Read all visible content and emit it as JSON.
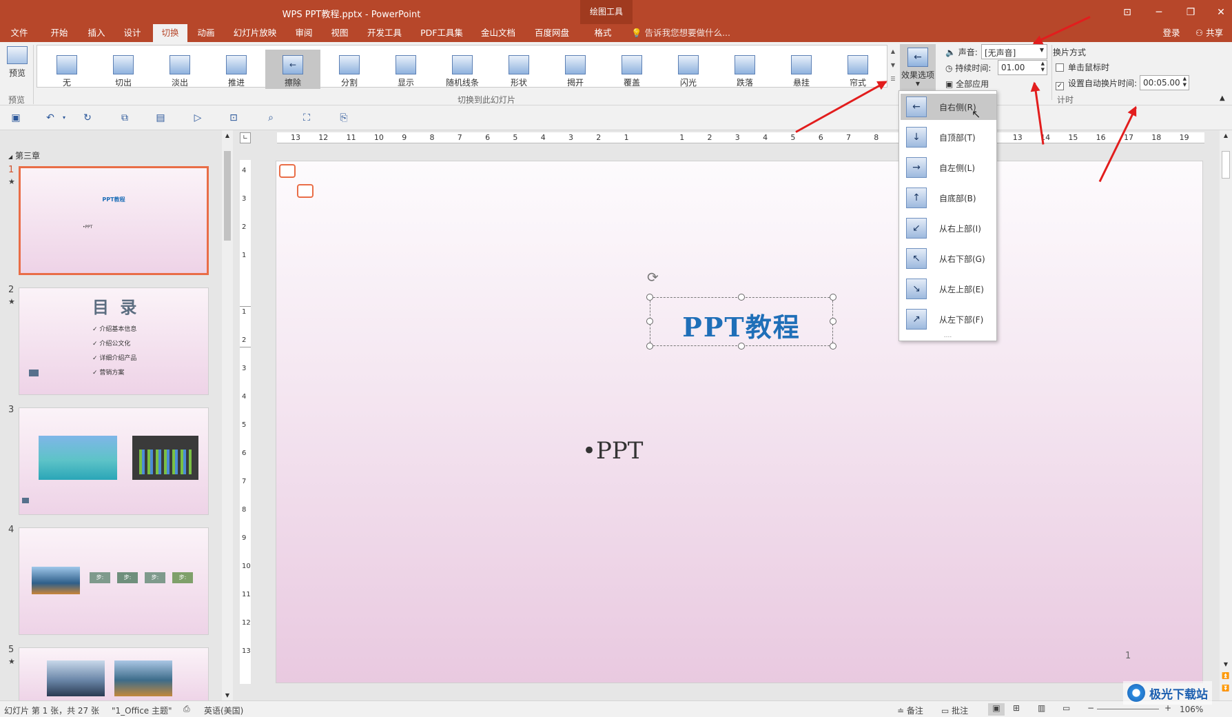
{
  "window": {
    "title": "WPS PPT教程.pptx - PowerPoint",
    "context_tab_group": "绘图工具",
    "minimize": "─",
    "restore": "❐",
    "close": "✕",
    "ribbon_display": "⊡"
  },
  "tabs": [
    {
      "label": "文件"
    },
    {
      "label": "开始"
    },
    {
      "label": "插入"
    },
    {
      "label": "设计"
    },
    {
      "label": "切换"
    },
    {
      "label": "动画"
    },
    {
      "label": "幻灯片放映"
    },
    {
      "label": "审阅"
    },
    {
      "label": "视图"
    },
    {
      "label": "开发工具"
    },
    {
      "label": "PDF工具集"
    },
    {
      "label": "金山文档"
    },
    {
      "label": "百度网盘"
    },
    {
      "label": "格式"
    }
  ],
  "tell_me": "告诉我您想要做什么...",
  "login": "登录",
  "share": "共享",
  "ribbon": {
    "preview_label": "预览",
    "preview_group": "预览",
    "transitions": [
      "无",
      "切出",
      "淡出",
      "推进",
      "擦除",
      "分割",
      "显示",
      "随机线条",
      "形状",
      "揭开",
      "覆盖",
      "闪光",
      "跌落",
      "悬挂",
      "帘式"
    ],
    "selected_transition": "擦除",
    "transitions_group": "切换到此幻灯片",
    "effect_options": "效果选项",
    "sound_label": "声音:",
    "sound_value": "[无声音]",
    "duration_label": "持续时间:",
    "duration_value": "01.00",
    "apply_all": "全部应用",
    "advance_title": "换片方式",
    "on_click": "单击鼠标时",
    "on_click_checked": false,
    "after_time": "设置自动换片时间:",
    "after_time_checked": true,
    "after_value": "00:05.00",
    "timing_group": "计时"
  },
  "dropdown": [
    {
      "label": "自右侧(R)",
      "glyph": "←"
    },
    {
      "label": "自顶部(T)",
      "glyph": "↓"
    },
    {
      "label": "自左侧(L)",
      "glyph": "→"
    },
    {
      "label": "自底部(B)",
      "glyph": "↑"
    },
    {
      "label": "从右上部(I)",
      "glyph": "↙"
    },
    {
      "label": "从右下部(G)",
      "glyph": "↖"
    },
    {
      "label": "从左上部(E)",
      "glyph": "↘"
    },
    {
      "label": "从左下部(F)",
      "glyph": "↗"
    }
  ],
  "dropdown_more": "....",
  "section": "第三章",
  "thumbnails": [
    {
      "num": "1",
      "title": "PPT教程",
      "bullet": "•PPT"
    },
    {
      "num": "2",
      "title": "目 录",
      "items": [
        "介绍基本信息",
        "介绍公文化",
        "详细介绍产品",
        "营销方案"
      ]
    },
    {
      "num": "3"
    },
    {
      "num": "4",
      "steps": [
        "步:",
        "步:",
        "步:",
        "步:"
      ]
    },
    {
      "num": "5"
    }
  ],
  "ruler_h": [
    "13",
    "12",
    "11",
    "10",
    "9",
    "8",
    "7",
    "6",
    "5",
    "4",
    "3",
    "2",
    "1",
    "",
    "1",
    "2",
    "3",
    "4",
    "5",
    "6",
    "7",
    "8",
    "9",
    "10",
    "11",
    "12",
    "13",
    "14",
    "15",
    "16",
    "17",
    "18",
    "19"
  ],
  "slide": {
    "title": "PPT教程",
    "bullet": "•PPT",
    "page": "1"
  },
  "status": {
    "slide_info": "幻灯片 第 1 张，共 27 张",
    "theme": "\"1_Office 主题\"",
    "language": "英语(美国)",
    "notes": "备注",
    "comments": "批注",
    "zoom": "106%"
  },
  "watermark": "极光下载站",
  "colors": {
    "accent": "#b7472a",
    "title_blue": "#1f6fb8",
    "arrow": "#e21d1d"
  }
}
